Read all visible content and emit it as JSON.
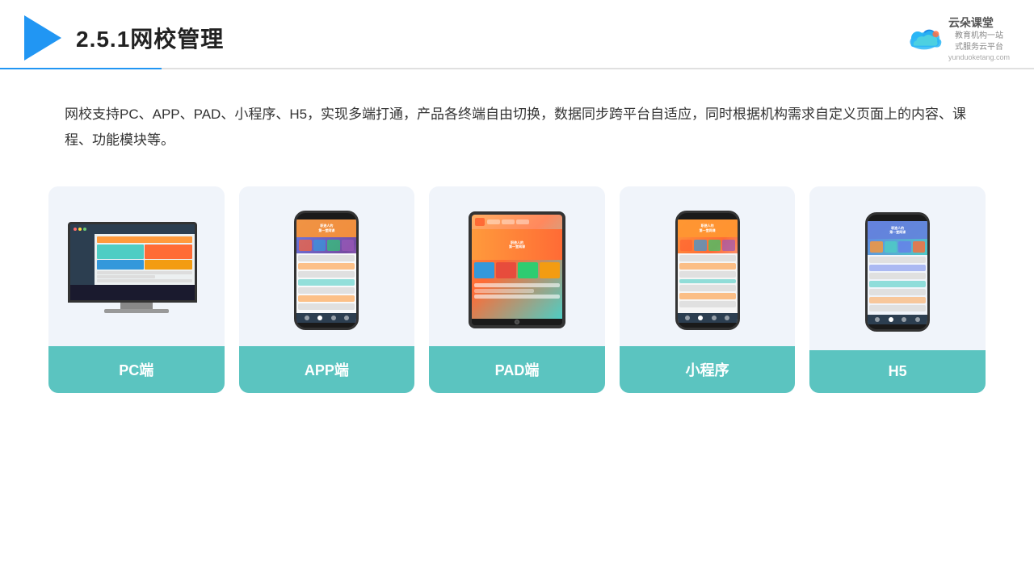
{
  "header": {
    "title": "2.5.1网校管理",
    "brand": {
      "name": "云朵课堂",
      "url": "yunduoketang.com",
      "subtitle": "教育机构一站\n式服务云平台"
    }
  },
  "description": "网校支持PC、APP、PAD、小程序、H5，实现多端打通，产品各终端自由切换，数据同步跨平台自适应，同时根据机构需求自定义页面上的内容、课程、功能模块等。",
  "cards": [
    {
      "id": "pc",
      "label": "PC端",
      "device": "pc"
    },
    {
      "id": "app",
      "label": "APP端",
      "device": "phone"
    },
    {
      "id": "pad",
      "label": "PAD端",
      "device": "tablet"
    },
    {
      "id": "miniprogram",
      "label": "小程序",
      "device": "phone-mini"
    },
    {
      "id": "h5",
      "label": "H5",
      "device": "phone-h5"
    }
  ],
  "colors": {
    "accent": "#5bc4c0",
    "header_line": "#2196F3",
    "bg_card": "#eef2fa"
  }
}
